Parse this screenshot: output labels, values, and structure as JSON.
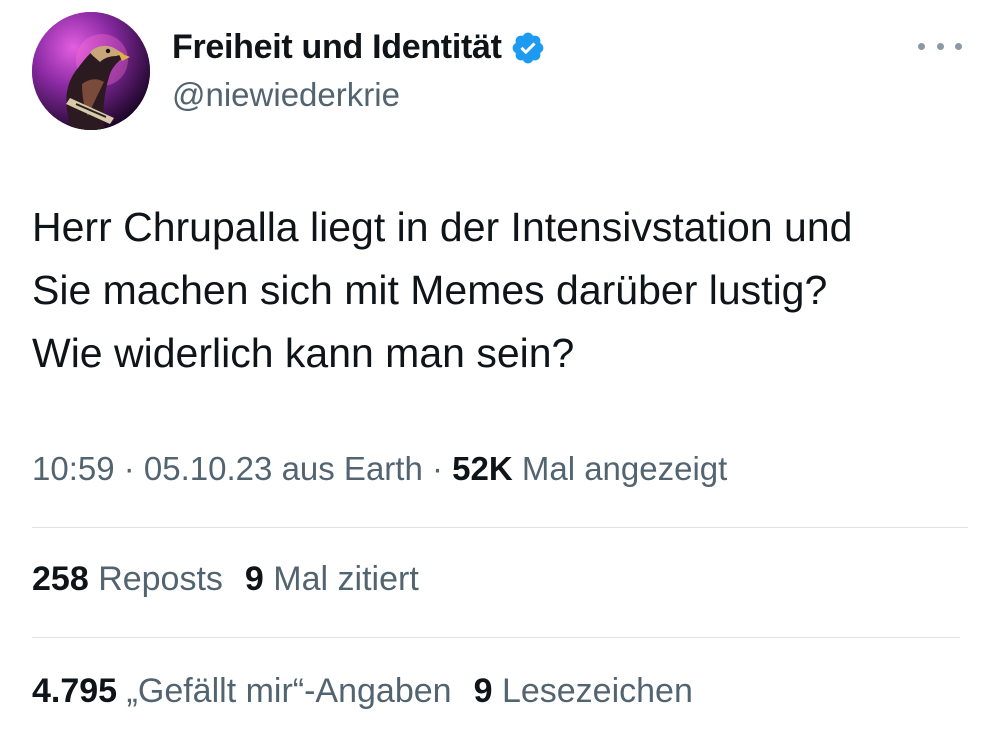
{
  "author": {
    "display_name": "Freiheit und Identität",
    "handle": "@niewiederkrie",
    "verified_icon": "verified-badge-icon",
    "avatar_icon": "eagle-avatar"
  },
  "menu": {
    "more_icon": "more-options-icon"
  },
  "tweet": {
    "lines": [
      "Herr Chrupalla liegt in der Intensivstation und",
      "Sie machen sich mit Memes darüber lustig?",
      "Wie widerlich kann man sein?"
    ]
  },
  "meta": {
    "time": "10:59",
    "separator": " · ",
    "date": "05.10.23",
    "source": "aus Earth",
    "views_count": "52K",
    "views_label": "Mal angezeigt"
  },
  "stats_row1": [
    {
      "count": "258",
      "label": "Reposts"
    },
    {
      "count": "9",
      "label": "Mal zitiert"
    }
  ],
  "stats_row2": [
    {
      "count": "4.795",
      "label": "„Gefällt mir“-Angaben"
    },
    {
      "count": "9",
      "label": "Lesezeichen"
    }
  ],
  "colors": {
    "text_primary": "#0f1419",
    "text_secondary": "#536471",
    "verified_blue": "#1d9bf0",
    "divider": "#dfe3e6"
  }
}
